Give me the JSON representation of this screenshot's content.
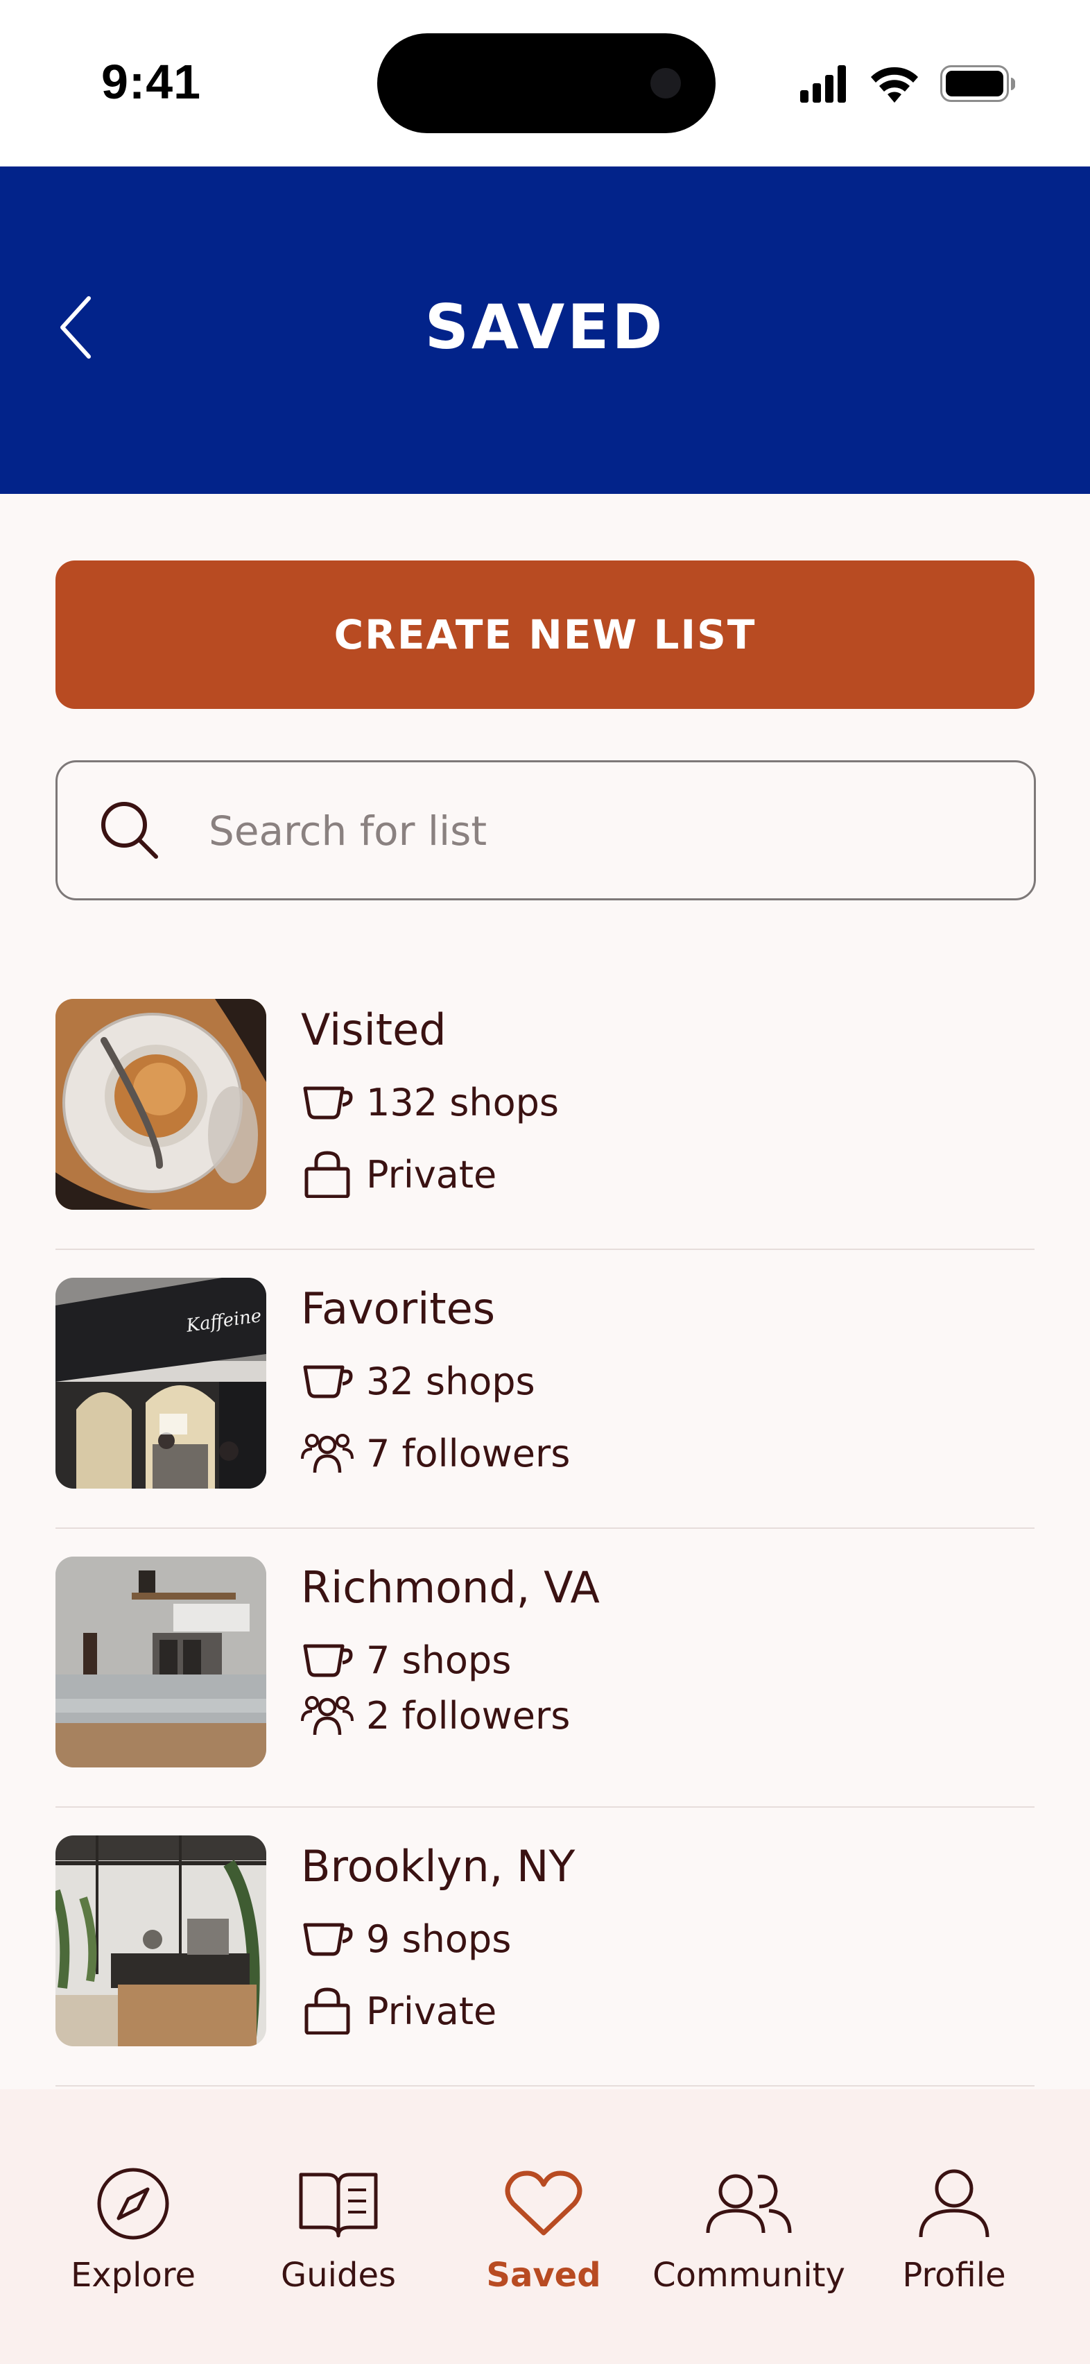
{
  "status_bar": {
    "time": "9:41"
  },
  "header": {
    "title": "SAVED"
  },
  "create_button": {
    "label": "CREATE NEW LIST"
  },
  "search": {
    "placeholder": "Search for list"
  },
  "lists": [
    {
      "name": "Visited",
      "shops": "132 shops",
      "secondary": "Private",
      "secondary_icon": "lock-icon"
    },
    {
      "name": "Favorites",
      "shops": "32 shops",
      "secondary": "7 followers",
      "secondary_icon": "followers-icon"
    },
    {
      "name": "Richmond, VA",
      "shops": "7 shops",
      "secondary": "2 followers",
      "secondary_icon": "followers-icon"
    },
    {
      "name": "Brooklyn, NY",
      "shops": "9 shops",
      "secondary": "Private",
      "secondary_icon": "lock-icon"
    }
  ],
  "nav": {
    "items": [
      {
        "label": "Explore",
        "icon": "compass-icon"
      },
      {
        "label": "Guides",
        "icon": "book-icon"
      },
      {
        "label": "Saved",
        "icon": "heart-icon",
        "active": true
      },
      {
        "label": "Community",
        "icon": "community-icon"
      },
      {
        "label": "Profile",
        "icon": "profile-icon"
      }
    ]
  },
  "colors": {
    "header": "#02238A",
    "accent": "#B84B22",
    "text": "#3A1212",
    "background": "#FCF8F7"
  }
}
